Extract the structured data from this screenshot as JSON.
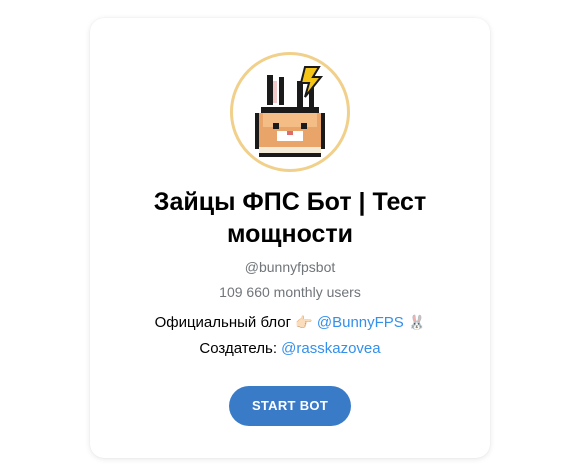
{
  "bot": {
    "title": "Зайцы ФПС Бот | Тест мощности",
    "username": "@bunnyfpsbot",
    "monthly_users": "109 660 monthly users",
    "description": {
      "line1_text": "Официальный блог ",
      "line1_pointer_emoji": "👉🏻",
      "line1_link": "@BunnyFPS",
      "line1_rabbit_emoji": "🐰",
      "line2_text": "Создатель: ",
      "line2_link": "@rasskazovea"
    },
    "start_label": "START BOT",
    "avatar_icon": "pixel-bunny-icon"
  },
  "colors": {
    "link": "#3390ec",
    "button": "#3a7bc8",
    "muted_text": "#707579",
    "avatar_ring": "#f0d08a"
  }
}
